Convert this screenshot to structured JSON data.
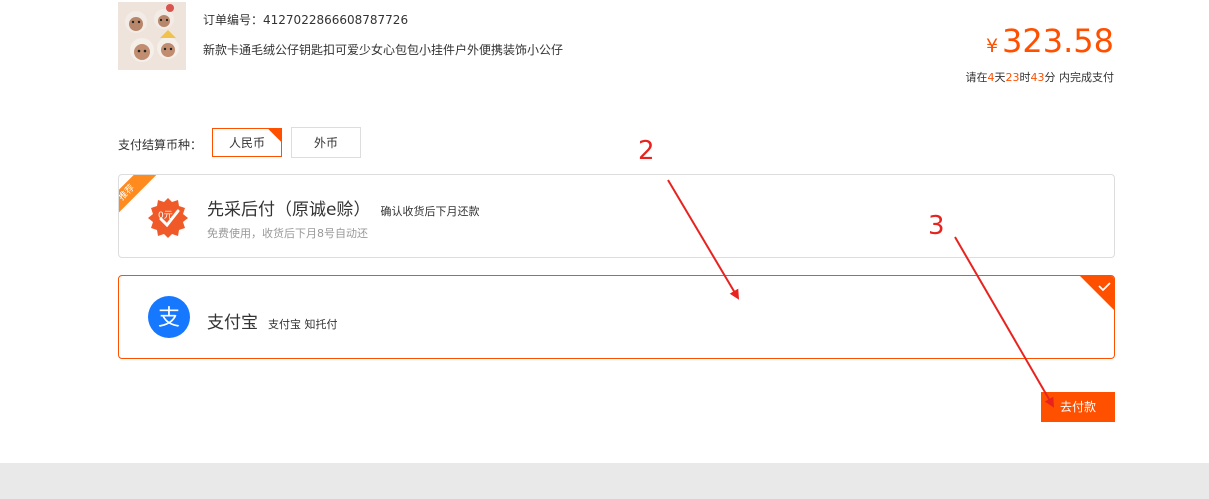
{
  "order": {
    "number_label": "订单编号：",
    "number": "4127022866608787726",
    "title": "新款卡通毛绒公仔钥匙扣可爱少女心包包小挂件户外便携装饰小公仔",
    "currency_symbol": "¥",
    "amount": "323.58",
    "deadline": {
      "prefix": "请在",
      "days": "4",
      "days_unit": "天",
      "hours": "23",
      "hours_unit": "时",
      "minutes": "43",
      "suffix": "分 内完成支付"
    }
  },
  "currency": {
    "label": "支付结算币种：",
    "options": [
      "人民币",
      "外币"
    ],
    "selected": "人民币"
  },
  "payment_methods": [
    {
      "badge": "推荐",
      "title": "先采后付（原诚e赊）",
      "subtitle": "确认收货后下月还款",
      "description": "免费使用，收货后下月8号自动还",
      "icon": "credit-badge-icon",
      "icon_text": "0元",
      "selected": false
    },
    {
      "title": "支付宝",
      "subtitle": "支付宝 知托付",
      "icon": "alipay-icon",
      "icon_text": "支",
      "selected": true
    }
  ],
  "pay_button": "去付款",
  "annotations": [
    "2",
    "3"
  ],
  "colors": {
    "accent": "#ff5000",
    "badge": "#ff8a1e",
    "alipay": "#1677ff",
    "annotation": "#e8231f",
    "footer_bg": "#e9e9e9"
  }
}
